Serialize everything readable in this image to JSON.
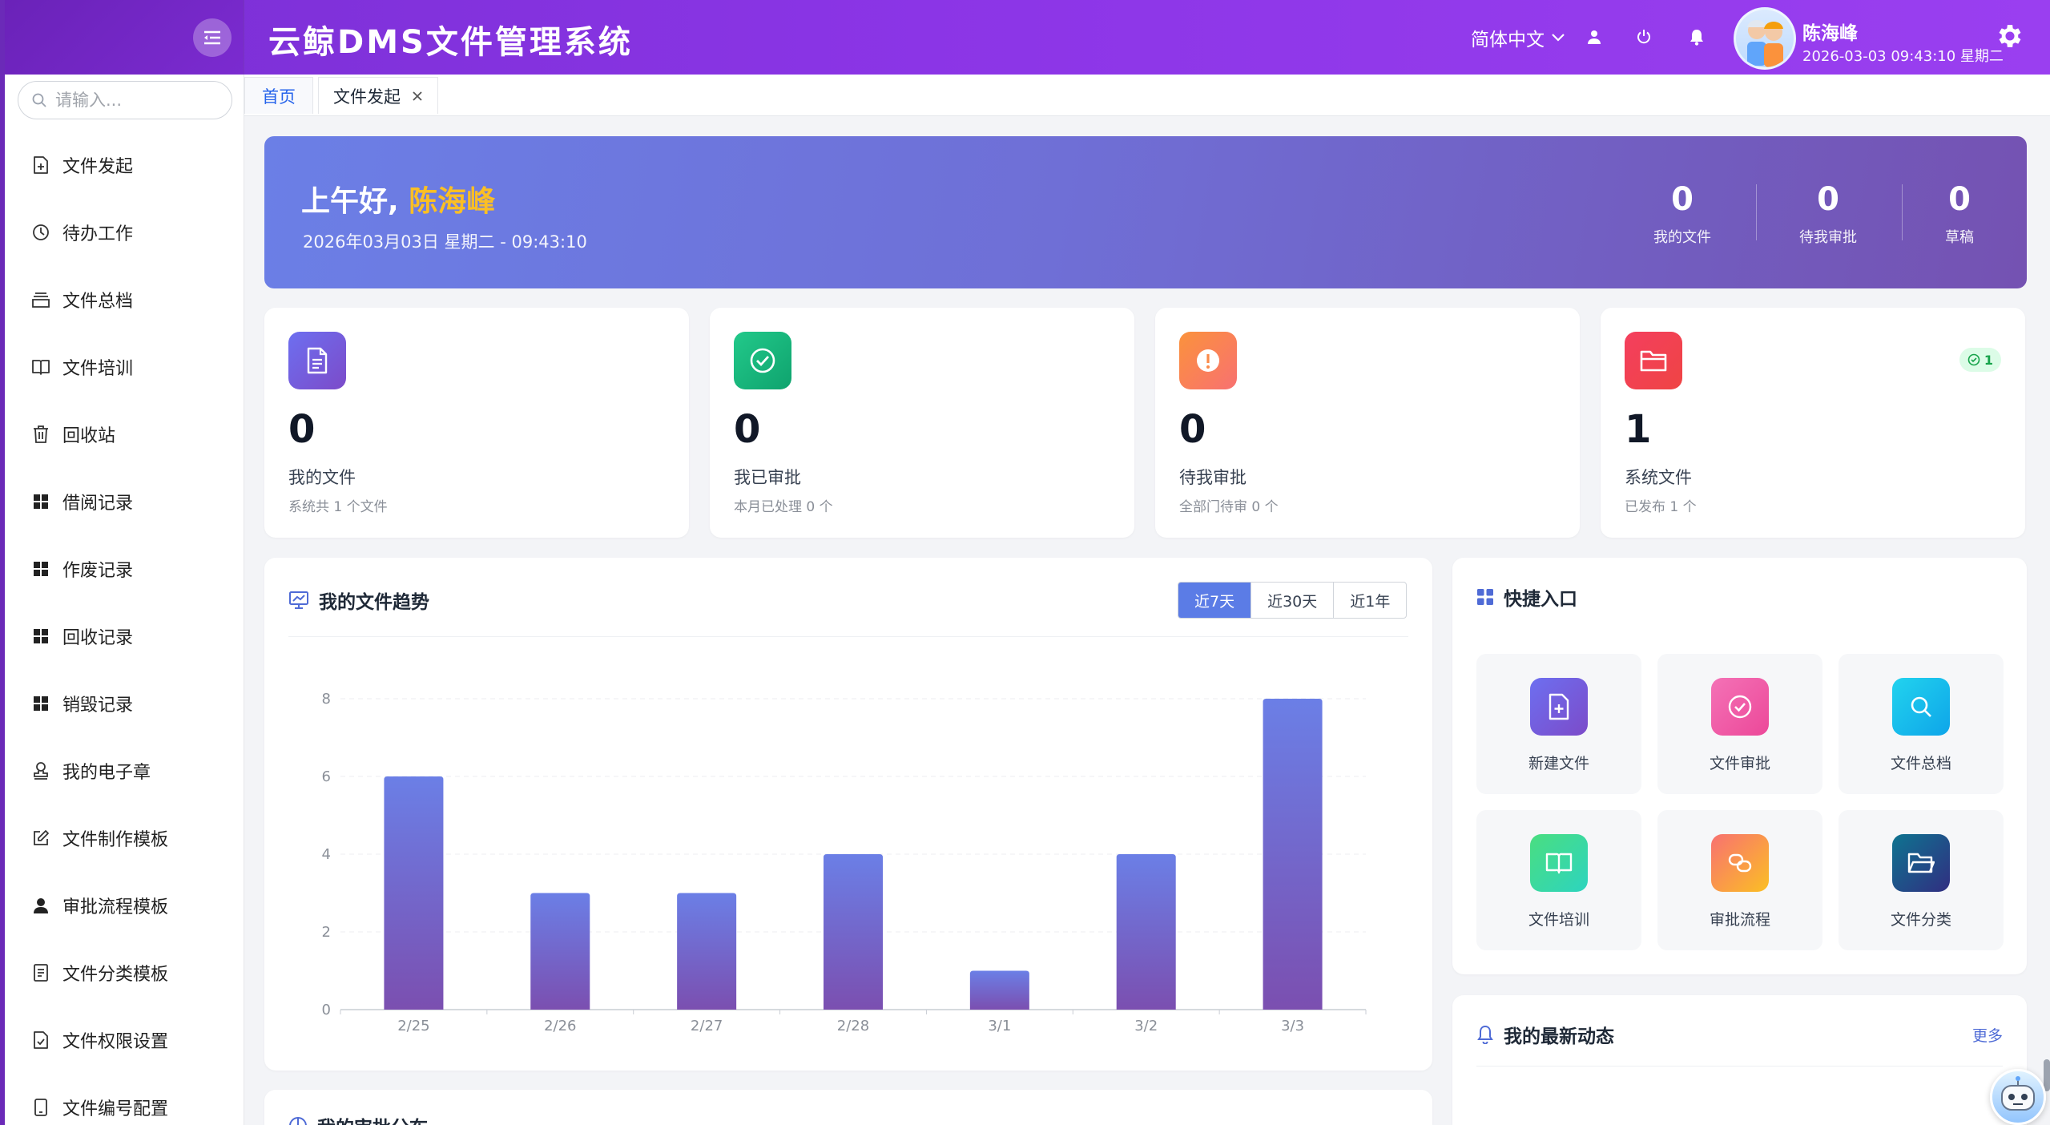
{
  "header": {
    "title": "云鲸DMS文件管理系统",
    "language": "简体中文",
    "user_name": "陈海峰",
    "user_datetime": "2026-03-03 09:43:10 星期二"
  },
  "sidebar": {
    "search_placeholder": "请输入...",
    "items": [
      {
        "label": "文件发起",
        "icon": "file-plus-icon"
      },
      {
        "label": "待办工作",
        "icon": "clock-icon"
      },
      {
        "label": "文件总档",
        "icon": "archive-icon"
      },
      {
        "label": "文件培训",
        "icon": "book-icon"
      },
      {
        "label": "回收站",
        "icon": "trash-icon"
      },
      {
        "label": "借阅记录",
        "icon": "grid-icon"
      },
      {
        "label": "作废记录",
        "icon": "grid-icon"
      },
      {
        "label": "回收记录",
        "icon": "grid-icon"
      },
      {
        "label": "销毁记录",
        "icon": "grid-icon"
      },
      {
        "label": "我的电子章",
        "icon": "stamp-icon"
      },
      {
        "label": "文件制作模板",
        "icon": "edit-icon"
      },
      {
        "label": "审批流程模板",
        "icon": "person-icon"
      },
      {
        "label": "文件分类模板",
        "icon": "list-icon"
      },
      {
        "label": "文件权限设置",
        "icon": "file-check-icon"
      },
      {
        "label": "文件编号配置",
        "icon": "phone-icon"
      }
    ]
  },
  "tabs": [
    {
      "label": "首页",
      "active": true
    },
    {
      "label": "文件发起",
      "active": false,
      "closable": true
    }
  ],
  "banner": {
    "greeting": "上午好, ",
    "name": "陈海峰",
    "date": "2026年03月03日 星期二 - 09:43:10",
    "stats": [
      {
        "value": "0",
        "label": "我的文件"
      },
      {
        "value": "0",
        "label": "待我审批"
      },
      {
        "value": "0",
        "label": "草稿"
      }
    ]
  },
  "stat_cards": [
    {
      "value": "0",
      "title": "我的文件",
      "sub": "系统共 1 个文件",
      "icon": "document-icon",
      "color_from": "#6d6ff0",
      "color_to": "#7c4bc9"
    },
    {
      "value": "0",
      "title": "我已审批",
      "sub": "本月已处理 0 个",
      "icon": "check-circle-icon",
      "color_from": "#22c98a",
      "color_to": "#0fa36e"
    },
    {
      "value": "0",
      "title": "待我审批",
      "sub": "全部门待审 0 个",
      "icon": "alert-icon",
      "color_from": "#fb923c",
      "color_to": "#f87171"
    },
    {
      "value": "1",
      "title": "系统文件",
      "sub": "已发布 1 个",
      "icon": "folder-icon",
      "color_from": "#f43f5e",
      "color_to": "#ef4444",
      "badge": "1"
    }
  ],
  "trend": {
    "title": "我的文件趋势",
    "ranges": [
      "近7天",
      "近30天",
      "近1年"
    ],
    "selected_range": "近7天"
  },
  "chart_data": {
    "type": "bar",
    "categories": [
      "2/25",
      "2/26",
      "2/27",
      "2/28",
      "3/1",
      "3/2",
      "3/3"
    ],
    "values": [
      6,
      3,
      3,
      4,
      1,
      4,
      8
    ],
    "yticks": [
      0,
      2,
      4,
      6,
      8
    ],
    "ylim": [
      0,
      8
    ],
    "grid": true,
    "bar_color_top": "#6b7fe6",
    "bar_color_bottom": "#7b4fb0"
  },
  "quick": {
    "title": "快捷入口",
    "items": [
      {
        "label": "新建文件",
        "icon": "file-plus-icon",
        "c1": "#6d6ff0",
        "c2": "#7c4bc9"
      },
      {
        "label": "文件审批",
        "icon": "check-circle-icon",
        "c1": "#f472b6",
        "c2": "#ec4899"
      },
      {
        "label": "文件总档",
        "icon": "search-icon",
        "c1": "#22d3ee",
        "c2": "#0ea5e9"
      },
      {
        "label": "文件培训",
        "icon": "book-icon",
        "c1": "#4ade80",
        "c2": "#2dd4bf"
      },
      {
        "label": "审批流程",
        "icon": "link-icon",
        "c1": "#f87171",
        "c2": "#fbbf24"
      },
      {
        "label": "文件分类",
        "icon": "folder-open-icon",
        "c1": "#0e7490",
        "c2": "#312e81"
      }
    ]
  },
  "activity": {
    "title": "我的最新动态",
    "more": "更多"
  },
  "distribution": {
    "title": "我的审批分布"
  }
}
